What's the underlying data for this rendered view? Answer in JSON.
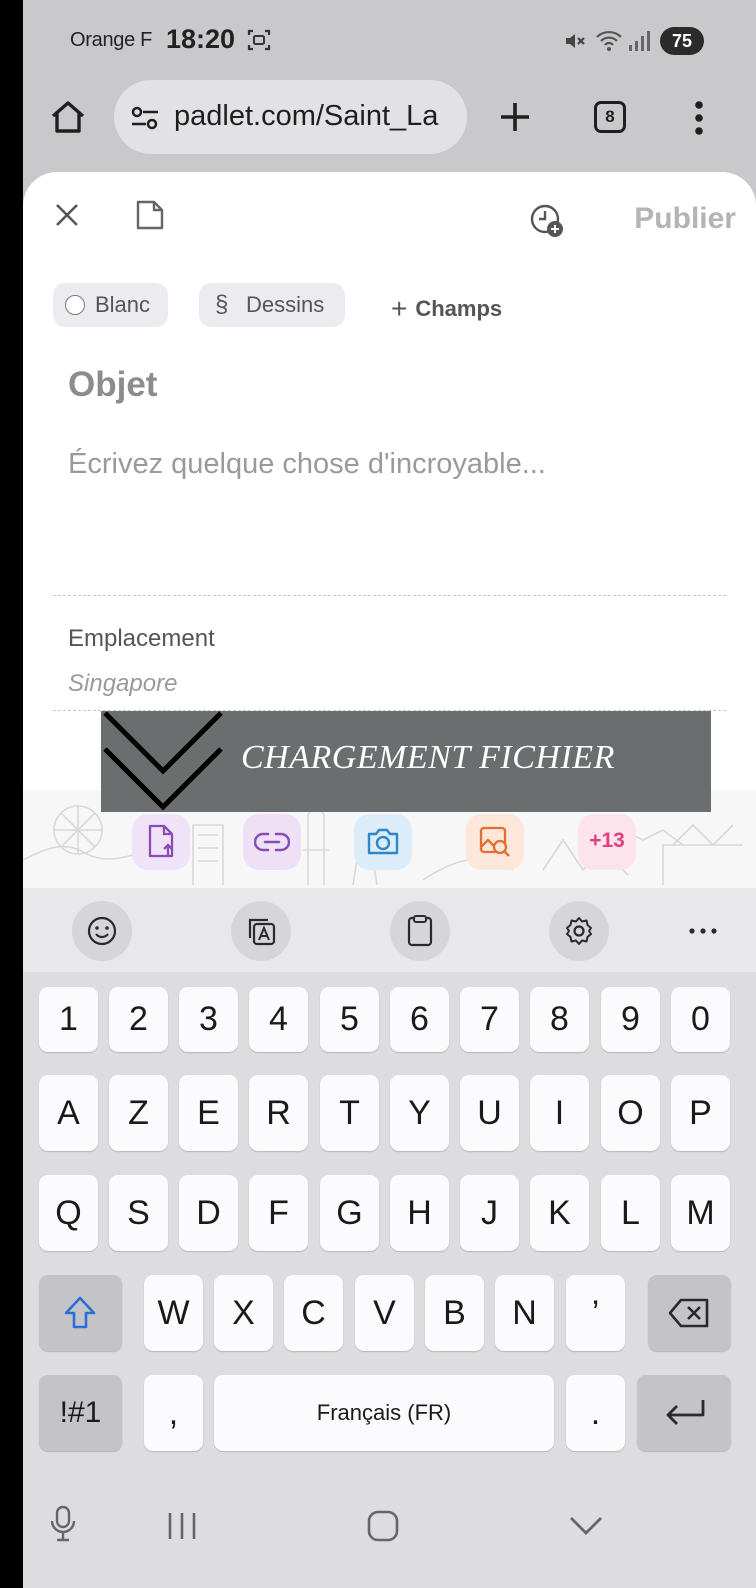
{
  "status_bar": {
    "carrier": "Orange F",
    "time": "18:20",
    "battery": "75"
  },
  "browser": {
    "url": "padlet.com/Saint_La",
    "tab_count": "8"
  },
  "composer": {
    "publish_label": "Publier",
    "chips": {
      "color": "Blanc",
      "section_symbol": "§",
      "section": "Dessins",
      "fields": "Champs"
    },
    "subject_placeholder": "Objet",
    "body_placeholder": "Écrivez quelque chose d'incroyable...",
    "location_label": "Emplacement",
    "location_placeholder": "Singapore"
  },
  "overlay": {
    "text": "CHARGEMENT FICHIER"
  },
  "attachments": {
    "more_label": "+13",
    "colors": {
      "upload": "#f1e3f7",
      "link": "#efe0f6",
      "camera": "#dcecf8",
      "image_search": "#fde6da",
      "more": "#fde4ec"
    }
  },
  "keyboard": {
    "numbers": [
      "1",
      "2",
      "3",
      "4",
      "5",
      "6",
      "7",
      "8",
      "9",
      "0"
    ],
    "row1": [
      "A",
      "Z",
      "E",
      "R",
      "T",
      "Y",
      "U",
      "I",
      "O",
      "P"
    ],
    "row2": [
      "Q",
      "S",
      "D",
      "F",
      "G",
      "H",
      "J",
      "K",
      "L",
      "M"
    ],
    "row3": [
      "W",
      "X",
      "C",
      "V",
      "B",
      "N",
      "’"
    ],
    "symbols_label": "!#1",
    "comma": ",",
    "space_label": "Français (FR)",
    "period": "."
  }
}
